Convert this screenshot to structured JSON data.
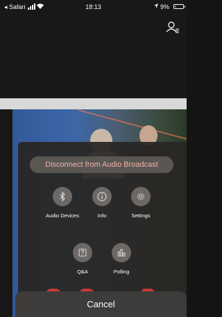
{
  "status_bar": {
    "back_app": "◂ Safari",
    "time": "18:13",
    "battery": "9%"
  },
  "menu": {
    "disconnect_label": "Disconnect from Audio Broadcast",
    "actions": [
      {
        "label": "Audio Devices",
        "icon": "bluetooth-icon"
      },
      {
        "label": "Info",
        "icon": "info-icon"
      },
      {
        "label": "Settings",
        "icon": "gear-icon"
      },
      {
        "label": "Q&A",
        "icon": "qa-icon"
      },
      {
        "label": "Polling",
        "icon": "polling-icon"
      }
    ],
    "cancel_label": "Cancel"
  },
  "colors": {
    "disconnect_text": "#f0b1a8",
    "battery_low": "#e0362c",
    "end_call_red": "#c63a33"
  }
}
